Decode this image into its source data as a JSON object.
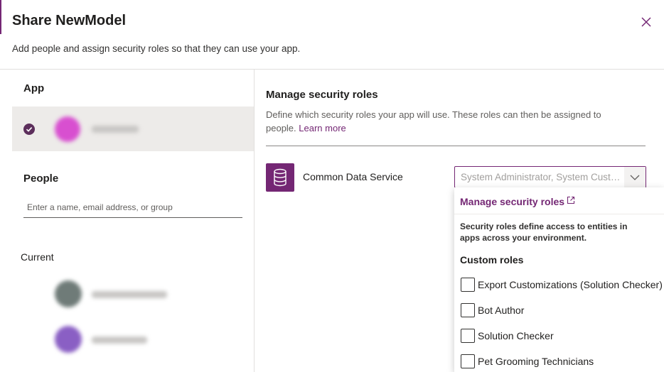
{
  "dialog": {
    "title": "Share NewModel",
    "subtitle": "Add people and assign security roles so that they can use your app."
  },
  "app_section": {
    "label": "App"
  },
  "people_section": {
    "label": "People",
    "input_placeholder": "Enter a name, email address, or group",
    "current_label": "Current"
  },
  "manage_roles": {
    "title": "Manage security roles",
    "description": "Define which security roles your app will use. These roles can then be assigned to people.",
    "learn_more": "Learn more"
  },
  "data_source": {
    "name": "Common Data Service",
    "selected_roles_text": "System Administrator, System Customizer"
  },
  "dropdown": {
    "manage_link": "Manage security roles",
    "description": "Security roles define access to entities in apps across your environment.",
    "custom_roles_label": "Custom roles",
    "roles": [
      {
        "label": "Export Customizations (Solution Checker)",
        "checked": false
      },
      {
        "label": "Bot Author",
        "checked": false
      },
      {
        "label": "Solution Checker",
        "checked": false
      },
      {
        "label": "Pet Grooming Technicians",
        "checked": false
      }
    ]
  },
  "colors": {
    "accent": "#742774",
    "check": "#5c2e5b",
    "app_avatar": "#d84fd0"
  }
}
